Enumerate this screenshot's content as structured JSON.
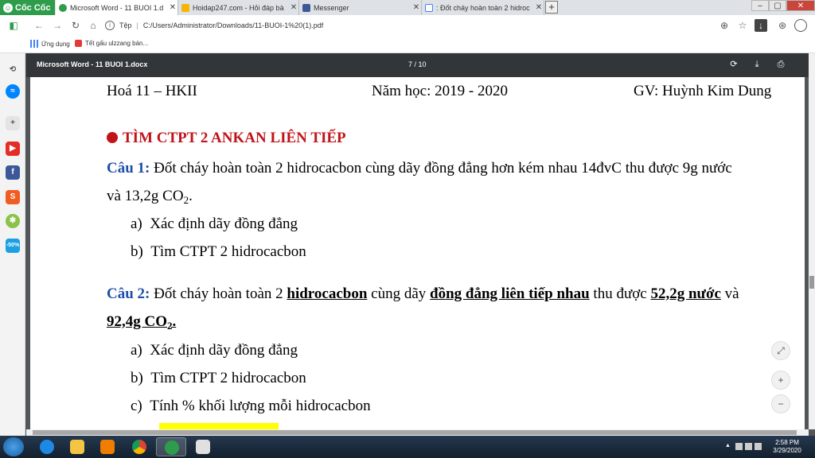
{
  "browser": {
    "brand": "Cốc Cốc",
    "tabs": [
      {
        "label": "Microsoft Word - 11 BUOI 1.d",
        "active": true,
        "favicon": "chrome-doc-icon"
      },
      {
        "label": "Hoidap247.com - Hỏi đáp bà",
        "active": false,
        "favicon": "hoidap-icon"
      },
      {
        "label": "Messenger",
        "active": false,
        "favicon": "facebook-icon"
      },
      {
        "label": ": Đốt cháy hoàn toàn 2 hidroc",
        "active": false,
        "favicon": "google-icon"
      }
    ],
    "new_tab": "+",
    "address": {
      "label": "Tệp",
      "url": "C:/Users/Administrator/Downloads/11-BUOI-1%20(1).pdf"
    },
    "bookmarks": [
      {
        "label": "Ứng dụng"
      },
      {
        "label": "Tết gấu ulzzang bán..."
      }
    ]
  },
  "sidebar": {
    "items": [
      "tiktok",
      "messenger",
      "add",
      "youtube",
      "facebook",
      "shopee",
      "coccoc-game",
      "sale"
    ],
    "sale_label": "-50%"
  },
  "pdf": {
    "title": "Microsoft Word - 11 BUOI 1.docx",
    "page_indicator": "7 / 10"
  },
  "document": {
    "header": {
      "left": "Hoá 11 – HKII",
      "center": "Năm học: 2019 - 2020",
      "right": "GV: Huỳnh Kim Dung"
    },
    "section_title": "TÌM CTPT 2 ANKAN LIÊN TIẾP",
    "q1": {
      "label": "Câu 1:",
      "text_line1": " Đốt cháy hoàn toàn 2 hidrocacbon cùng dãy đồng đẳng hơn kém nhau 14đvC thu được 9g nước",
      "text_line2_a": "và 13,2g CO",
      "text_line2_sub": "2",
      "text_line2_b": ".",
      "items": [
        {
          "marker": "a)",
          "text": "Xác định dãy đồng đẳng"
        },
        {
          "marker": "b)",
          "text": "Tìm CTPT 2 hidrocacbon"
        }
      ]
    },
    "q2": {
      "label": "Câu 2:",
      "p1": " Đốt cháy hoàn toàn 2 ",
      "u1": "hidrocacbon",
      "p2": " cùng dãy ",
      "u2": "đồng đẳng liên tiếp nhau",
      "p3": " thu được ",
      "u3": "52,2g nước",
      "p4": " và",
      "line2_a": "92,4g CO",
      "line2_sub": "2",
      "line2_b": ".",
      "items": [
        {
          "marker": "a)",
          "text": "Xác định dãy đồng đẳng"
        },
        {
          "marker": "b)",
          "text": "Tìm CTPT 2 hidrocacbon"
        },
        {
          "marker": "c)",
          "text": "Tính % khối lượng mỗi hidrocacbon"
        }
      ]
    }
  },
  "taskbar": {
    "time": "2:58 PM",
    "date": "3/29/2020"
  }
}
